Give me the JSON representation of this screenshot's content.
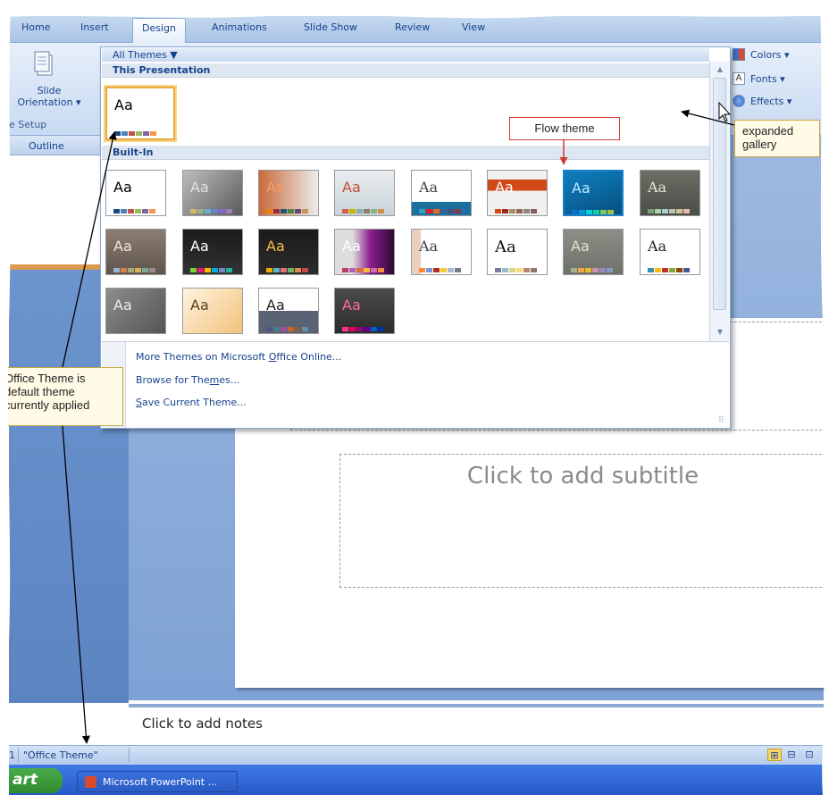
{
  "ribbon": {
    "tabs": [
      {
        "label": "Home",
        "active": false
      },
      {
        "label": "Insert",
        "active": false
      },
      {
        "label": "Design",
        "active": true
      },
      {
        "label": "Animations",
        "active": false
      },
      {
        "label": "Slide Show",
        "active": false
      },
      {
        "label": "Review",
        "active": false
      },
      {
        "label": "View",
        "active": false
      }
    ],
    "slide_orientation": {
      "line1": "Slide",
      "line2": "Orientation ▾"
    },
    "page_setup_group": "e Setup",
    "right_group": {
      "colors": "Colors ▾",
      "fonts": "Fonts ▾",
      "effects": "Effects ▾",
      "font_icon": "A"
    }
  },
  "left_pane": {
    "outline_tab": "Outline"
  },
  "gallery": {
    "header": "All Themes ▼",
    "this_presentation_label": "This Presentation",
    "built_in_label": "Built-In",
    "thumb_text": "Aa",
    "links": {
      "more_themes_pre": "More Themes on Microsoft ",
      "more_themes_u": "O",
      "more_themes_post": "ffice Online...",
      "browse_pre": "Browse for The",
      "browse_u": "m",
      "browse_post": "es...",
      "save_u": "S",
      "save_post": "ave Current Theme..."
    },
    "scroll": {
      "up": "▲",
      "down": "▼"
    }
  },
  "slide": {
    "subtitle_placeholder": "Click to add subtitle"
  },
  "notes": {
    "placeholder": "Click to add notes"
  },
  "status": {
    "slide_number": "1",
    "theme_name": "\"Office Theme\"",
    "view_icons": [
      "⊞",
      "⊟",
      "⊡"
    ]
  },
  "taskbar": {
    "start_label": "art",
    "app_button": "Microsoft PowerPoint ..."
  },
  "callouts": {
    "flow_theme": "Flow theme",
    "expanded_gallery_line1": "expanded",
    "expanded_gallery_line2": "gallery",
    "office_theme_line1": "Office Theme is",
    "office_theme_line2": "default theme",
    "office_theme_line3": "currently applied"
  },
  "colors": {
    "ribbon_text": "#15428b",
    "accent_selection": "#e8a845",
    "callout_border_red": "#d43a2f",
    "callout_bg": "#fffbe6"
  }
}
